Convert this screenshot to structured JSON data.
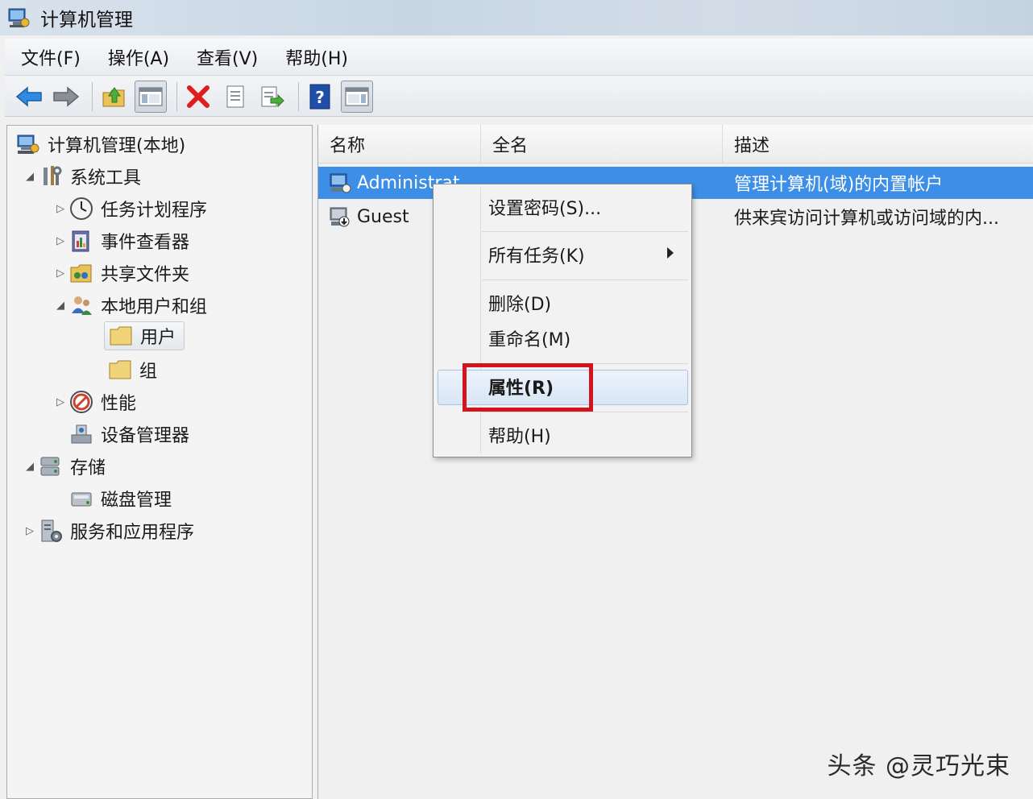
{
  "window": {
    "title": "计算机管理"
  },
  "menu": [
    "文件(F)",
    "操作(A)",
    "查看(V)",
    "帮助(H)"
  ],
  "toolbar": {
    "icons": [
      "back-arrow-icon",
      "forward-arrow-icon",
      "up-folder-icon",
      "show-hide-tree-icon",
      "delete-icon",
      "properties-icon",
      "export-icon",
      "help-icon",
      "action-pane-icon"
    ]
  },
  "tree": {
    "root": "计算机管理(本地)",
    "system_tools": "系统工具",
    "task_scheduler": "任务计划程序",
    "event_viewer": "事件查看器",
    "shared_folders": "共享文件夹",
    "local_users_groups": "本地用户和组",
    "users": "用户",
    "groups": "组",
    "performance": "性能",
    "device_manager": "设备管理器",
    "storage": "存储",
    "disk_management": "磁盘管理",
    "services_apps": "服务和应用程序"
  },
  "list": {
    "columns": [
      "名称",
      "全名",
      "描述"
    ],
    "rows": [
      {
        "name": "Administrat",
        "fullname": "",
        "desc": "管理计算机(域)的内置帐户"
      },
      {
        "name": "Guest",
        "fullname": "",
        "desc": "供来宾访问计算机或访问域的内..."
      }
    ]
  },
  "context_menu": {
    "set_password": "设置密码(S)...",
    "all_tasks": "所有任务(K)",
    "delete": "删除(D)",
    "rename": "重命名(M)",
    "properties": "属性(R)",
    "help": "帮助(H)"
  },
  "colors": {
    "selection": "#3d8ee6",
    "highlight_box": "#d4141d"
  },
  "watermark": "头条 @灵巧光束"
}
